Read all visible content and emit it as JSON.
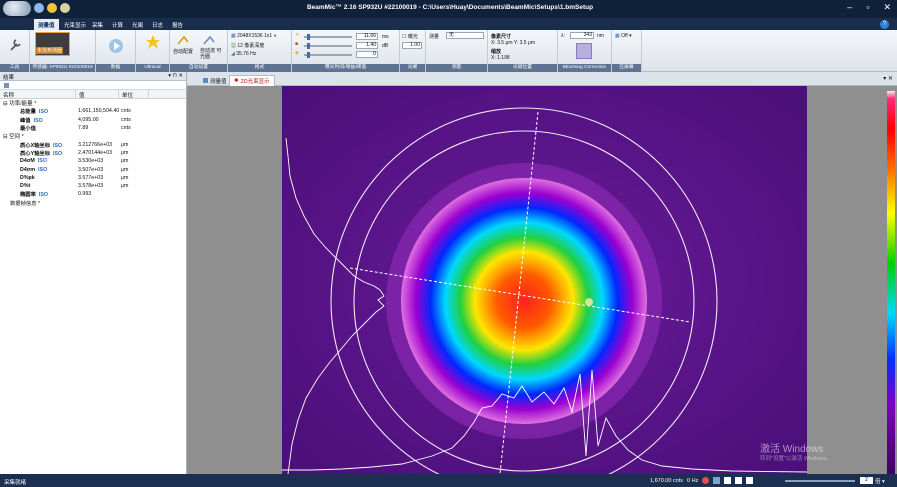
{
  "window": {
    "title": "BeamMic™ 2.16 SP932U #22100019 - C:\\Users\\Huay\\Documents\\BeamMic\\Setups\\1.bmSetup",
    "min": "–",
    "max": "▫",
    "close": "✕"
  },
  "tabs": [
    "测量值",
    "光束显示",
    "采集",
    "计算",
    "光阑",
    "日志",
    "报告"
  ],
  "help": "?",
  "ribbon": {
    "groups": {
      "tools": "工具",
      "camera": "传感器: SP932U #22100019",
      "record": "数据",
      "ultracal": "Ultracal",
      "autosetup": "自动设置",
      "format": "格式",
      "exposure": "曝光时间/增益/阈值",
      "aperture": "光阑",
      "measure": "测量",
      "beam_pos": "光斑位置",
      "blooming": "Blooming Correction",
      "display": "在屏幕"
    },
    "camera_btn": "未找到测器",
    "auto_btn_1": "自动配置",
    "auto_btn_2": "自动流 可 光圈",
    "format_res": "2048X1536 1x1",
    "format_bits": "12 像素深度",
    "format_rate": "35.76 Hz",
    "exp_value": "11.66",
    "exp_unit": "ms",
    "gain_value": "1.40",
    "gain_unit": "dB",
    "thr_value": "0",
    "aperture_label": "曝光",
    "aperture_value": "1.00",
    "measure_label": "测量",
    "measure_value": "无",
    "pixel_label": "像素尺寸",
    "pixel_value": "X: 3.5 μm  Y: 3.5 μm",
    "scale_label": "缩放",
    "scale_value": "X: 1.198",
    "lambda_label": "λ:",
    "lambda_value": "343",
    "lambda_unit": "nm",
    "off_label": "Off"
  },
  "results": {
    "title": "结果",
    "pin": "▾ ⊓ ✕",
    "columns": [
      "名称",
      "值",
      "单位"
    ],
    "sections": {
      "power": "⊟ 功率/能量 *",
      "spatial": "⊟ 空间 *",
      "info": "数据帧信息 *"
    },
    "power_rows": [
      {
        "name": "总能量",
        "iso": "ISO",
        "value": "1,661,150,504.40",
        "unit": "cnts"
      },
      {
        "name": "峰值",
        "iso": "ISO",
        "value": "4,095.00",
        "unit": "cnts"
      },
      {
        "name": "最小值",
        "iso": "",
        "value": "7.89",
        "unit": "cnts"
      }
    ],
    "spatial_rows": [
      {
        "name": "质心X轴坐标",
        "iso": "ISO",
        "value": "3.212766e+03",
        "unit": "μm"
      },
      {
        "name": "质心Y轴坐标",
        "iso": "ISO",
        "value": "2.470144e+03",
        "unit": "μm"
      },
      {
        "name": "D4σM",
        "iso": "ISO",
        "value": "3.530e+03",
        "unit": "μm"
      },
      {
        "name": "D4σm",
        "iso": "ISO",
        "value": "3.507e+03",
        "unit": "μm"
      },
      {
        "name": "D%pk",
        "iso": "",
        "value": "3.577e+03",
        "unit": "μm"
      },
      {
        "name": "D%t",
        "iso": "",
        "value": "3.578e+03",
        "unit": "μm"
      },
      {
        "name": "椭圆率",
        "iso": "ISO",
        "value": "0.993",
        "unit": ""
      }
    ]
  },
  "doc_tabs": [
    "测量值",
    "2D光束显示"
  ],
  "watermark": {
    "line1": "激活 Windows",
    "line2": "转到\"设置\"以激活 Windows。"
  },
  "status": {
    "left": "采集就绪",
    "counts": "1,670.00 cnts",
    "rate": "0 Hz",
    "zoom": "2",
    "zoom_unit": "倍 ▾"
  }
}
